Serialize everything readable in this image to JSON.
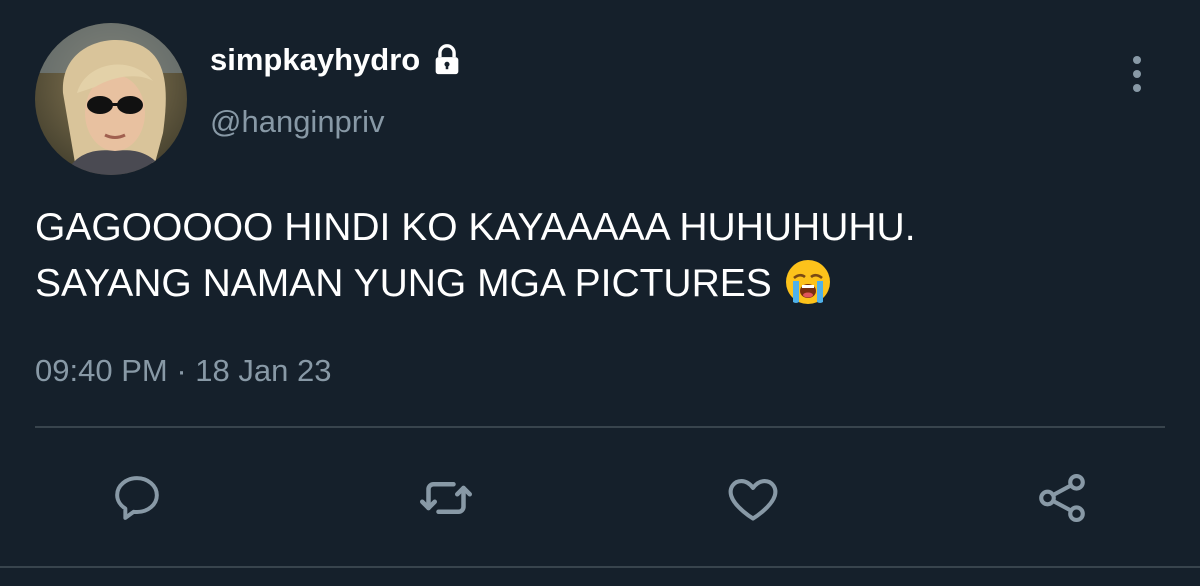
{
  "user": {
    "display_name": "simpkayhydro",
    "handle": "@hanginpriv",
    "verified_locked": true
  },
  "tweet": {
    "line1": "GAGOOOOO HINDI KO KAYAAAAA HUHUHUHU.",
    "line2": "SAYANG NAMAN YUNG MGA PICTURES",
    "emoji": "loudly-crying-face",
    "time": "09:40 PM",
    "separator": "·",
    "date": "18 Jan 23"
  },
  "actions": [
    {
      "name": "reply",
      "icon": "comment-icon"
    },
    {
      "name": "retweet",
      "icon": "retweet-icon"
    },
    {
      "name": "like",
      "icon": "heart-icon"
    },
    {
      "name": "share",
      "icon": "share-icon"
    }
  ],
  "colors": {
    "background": "#15202b",
    "primary_text": "#ffffff",
    "secondary_text": "#8899a6",
    "divider": "#38444d"
  }
}
